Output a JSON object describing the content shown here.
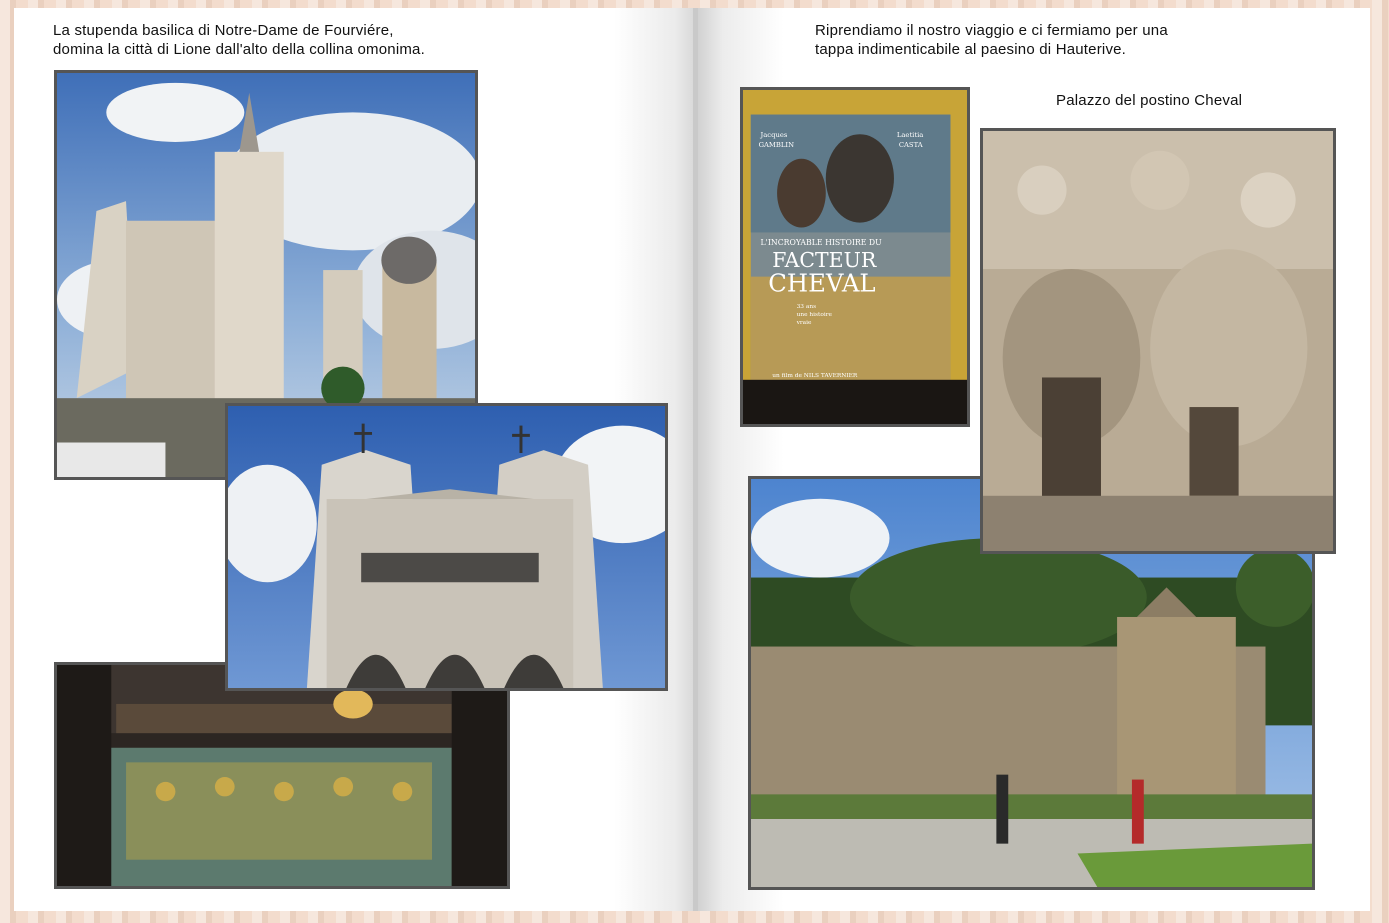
{
  "left_page": {
    "caption_line1": "La stupenda basilica di Notre-Dame de Fourviére,",
    "caption_line2": "domina la città di Lione dall'alto della collina omonima."
  },
  "right_page": {
    "caption_line1": "Riprendiamo il nostro viaggio e ci fermiamo per una",
    "caption_line2": "tappa indimenticabile al paesino di Hauterive.",
    "photo_label": "Palazzo del postino Cheval"
  },
  "poster": {
    "actor_left_first": "Jacques",
    "actor_left_last": "GAMBLIN",
    "actor_right_first": "Laetitia",
    "actor_right_last": "CASTA",
    "title_small": "L'INCROYABLE HISTOIRE DU",
    "title_big_1": "FACTEUR",
    "title_big_2": "CHEVAL",
    "tagline_1": "33 ans",
    "tagline_2": "une histoire",
    "tagline_3": "vraie",
    "credit": "un film de NILS TAVERNIER"
  },
  "colors": {
    "sky": "#4a79c2",
    "stone": "#d8cfc0",
    "photo_border": "#555555"
  }
}
